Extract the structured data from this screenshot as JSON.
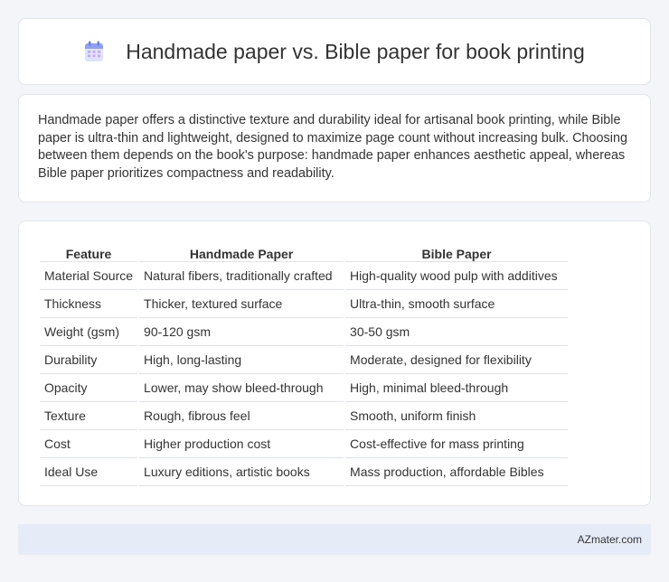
{
  "header": {
    "icon": "calendar-icon",
    "title": "Handmade paper vs. Bible paper for book printing"
  },
  "summary": {
    "text": "Handmade paper offers a distinctive texture and durability ideal for artisanal book printing, while Bible paper is ultra-thin and lightweight, designed to maximize page count without increasing bulk. Choosing between them depends on the book's purpose: handmade paper enhances aesthetic appeal, whereas Bible paper prioritizes compactness and readability."
  },
  "comparison_table": {
    "headers": [
      "Feature",
      "Handmade Paper",
      "Bible Paper"
    ],
    "rows": [
      [
        "Material Source",
        "Natural fibers, traditionally crafted",
        "High-quality wood pulp with additives"
      ],
      [
        "Thickness",
        "Thicker, textured surface",
        "Ultra-thin, smooth surface"
      ],
      [
        "Weight (gsm)",
        "90-120 gsm",
        "30-50 gsm"
      ],
      [
        "Durability",
        "High, long-lasting",
        "Moderate, designed for flexibility"
      ],
      [
        "Opacity",
        "Lower, may show bleed-through",
        "High, minimal bleed-through"
      ],
      [
        "Texture",
        "Rough, fibrous feel",
        "Smooth, uniform finish"
      ],
      [
        "Cost",
        "Higher production cost",
        "Cost-effective for mass printing"
      ],
      [
        "Ideal Use",
        "Luxury editions, artistic books",
        "Mass production, affordable Bibles"
      ]
    ]
  },
  "footer": {
    "text": "AZmater.com"
  },
  "colors": {
    "background": "#f3f5f9",
    "card": "#ffffff",
    "footer": "#e6ecf7",
    "icon_accent": "#7b8cf0"
  }
}
